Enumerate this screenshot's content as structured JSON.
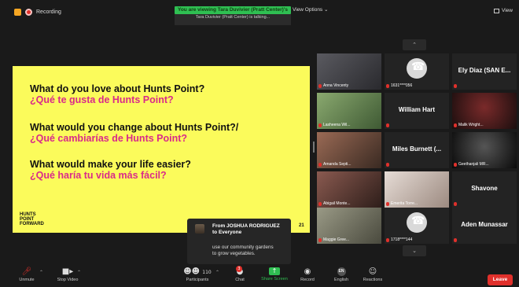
{
  "topbar": {
    "recording_label": "Recording",
    "viewing_banner": "You are viewing Tara Duvivier (Pratt Center)'s screen",
    "talking_tip": "Tara Duvivier (Pratt Center) is talking...",
    "view_options": "View Options ⌄",
    "view_label": "View"
  },
  "slide": {
    "questions": [
      {
        "en": "What do you love about Hunts Point?",
        "es": "¿Qué te gusta de Hunts Point?"
      },
      {
        "en": "What would you change about Hunts Point?/",
        "es": "¿Qué cambiarías de Hunts Point?"
      },
      {
        "en": "What would make your life easier?",
        "es": "¿Qué haría tu vida más fácil?"
      }
    ],
    "logo": [
      "HUNTS",
      "POINT",
      "FORWARD"
    ],
    "page_number": "21"
  },
  "gallery": {
    "tiles": [
      {
        "name": "Anna Vincenty",
        "kind": "photo",
        "color": "#3b3a3e"
      },
      {
        "name": "1631****056",
        "kind": "phone"
      },
      {
        "big": "Ely Diaz (SAN E...",
        "kind": "text"
      },
      {
        "name": "Lasheena Wil...",
        "kind": "photo",
        "color": "#6f8f5a"
      },
      {
        "big": "William Hart",
        "kind": "text"
      },
      {
        "name": "Malik Wright...",
        "kind": "photo",
        "color": "#4a1e1e"
      },
      {
        "name": "Amanda Septi...",
        "kind": "photo",
        "color": "#6b4a3a"
      },
      {
        "big": "Miles Burnett (...",
        "kind": "text"
      },
      {
        "name": "Geethanjali MR...",
        "kind": "photo",
        "color": "#141414"
      },
      {
        "name": "Abigail Monte...",
        "kind": "photo",
        "color": "#5a3a34"
      },
      {
        "name": "Emerita Torre...",
        "kind": "photo",
        "color": "#c9b9b0"
      },
      {
        "big": "Shavone",
        "kind": "text"
      },
      {
        "name": "Maggie Gree...",
        "kind": "photo",
        "color": "#7a7a6a"
      },
      {
        "name": "1718****144",
        "kind": "phone"
      },
      {
        "big": "Aden Munassar",
        "kind": "text"
      }
    ]
  },
  "chat": {
    "from": "From JOSHUA RODRIGUEZ",
    "to": "to Everyone",
    "message_line1": "use our community gardens",
    "message_line2": "to grow vegetables."
  },
  "toolbar": {
    "unmute": "Unmute",
    "stop_video": "Stop Video",
    "participants": "Participants",
    "participants_count": "110",
    "chat": "Chat",
    "chat_badge": "3",
    "share_screen": "Share Screen",
    "record": "Record",
    "english": "English",
    "language_badge": "EN",
    "reactions": "Reactions",
    "leave": "Leave"
  }
}
